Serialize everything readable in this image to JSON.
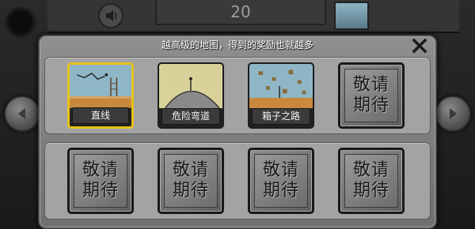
{
  "background": {
    "score": "20"
  },
  "dialog": {
    "title": "越高级的地图，得到的奖励也就越多",
    "close_icon": "close-icon",
    "locked_text": "敬请期待",
    "levels": [
      {
        "label": "直线",
        "selected": true,
        "art": "straight-line-scene"
      },
      {
        "label": "危险弯道",
        "selected": false,
        "art": "dangerous-curve-scene"
      },
      {
        "label": "箱子之路",
        "selected": false,
        "art": "box-road-scene"
      }
    ],
    "locked_slots": [
      {
        "text": "敬请\n期待"
      },
      {
        "text": "敬请\n期待"
      },
      {
        "text": "敬请\n期待"
      },
      {
        "text": "敬请\n期待"
      },
      {
        "text": "敬请\n期待"
      }
    ]
  },
  "navigation": {
    "left_icon": "chevron-left-icon",
    "right_icon": "chevron-right-icon"
  },
  "colors": {
    "selected_border": "#e7c31c",
    "dialog_bg": "#7f7f7f",
    "label_bg": "#3b3b3b"
  }
}
